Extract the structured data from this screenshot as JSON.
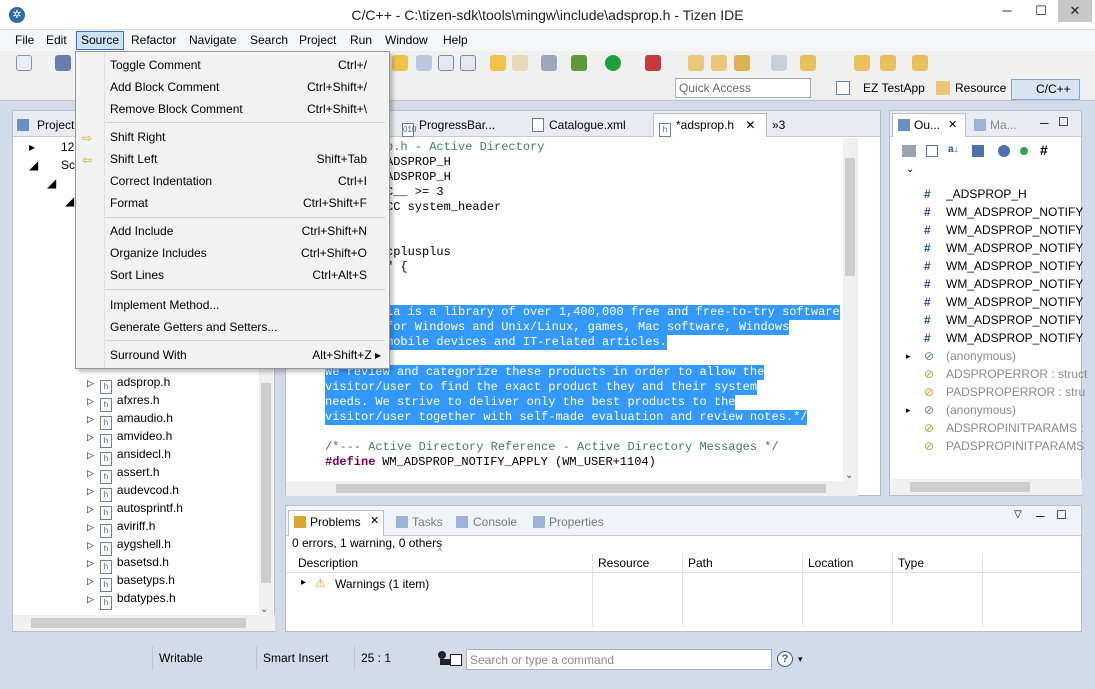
{
  "window": {
    "title": "C/C++ - C:\\tizen-sdk\\tools\\mingw\\include\\adsprop.h - Tizen IDE"
  },
  "menubar": [
    "File",
    "Edit",
    "Source",
    "Refactor",
    "Navigate",
    "Search",
    "Project",
    "Run",
    "Window",
    "Help"
  ],
  "quick_access": {
    "placeholder": "Quick Access"
  },
  "perspectives": [
    "EZ TestApp",
    "Resource",
    "C/C++"
  ],
  "source_menu": {
    "g1": [
      {
        "label": "Toggle Comment",
        "shortcut": "Ctrl+/"
      },
      {
        "label": "Add Block Comment",
        "shortcut": "Ctrl+Shift+/"
      },
      {
        "label": "Remove Block Comment",
        "shortcut": "Ctrl+Shift+\\"
      }
    ],
    "g2": [
      {
        "label": "Shift Right",
        "shortcut": ""
      },
      {
        "label": "Shift Left",
        "shortcut": "Shift+Tab"
      },
      {
        "label": "Correct Indentation",
        "shortcut": "Ctrl+I"
      },
      {
        "label": "Format",
        "shortcut": "Ctrl+Shift+F"
      }
    ],
    "g3": [
      {
        "label": "Add Include",
        "shortcut": "Ctrl+Shift+N"
      },
      {
        "label": "Organize Includes",
        "shortcut": "Ctrl+Shift+O"
      },
      {
        "label": "Sort Lines",
        "shortcut": "Ctrl+Alt+S"
      }
    ],
    "g4": [
      {
        "label": "Implement Method...",
        "shortcut": ""
      },
      {
        "label": "Generate Getters and Setters...",
        "shortcut": ""
      }
    ],
    "g5": [
      {
        "label": "Surround With",
        "shortcut": "Alt+Shift+Z ▸"
      }
    ]
  },
  "project_explorer": {
    "tab": "Project",
    "partial_rows": [
      "12",
      "Sc"
    ],
    "files": [
      "adsprop.h",
      "afxres.h",
      "amaudio.h",
      "amvideo.h",
      "ansidecl.h",
      "assert.h",
      "audevcod.h",
      "autosprintf.h",
      "aviriff.h",
      "aygshell.h",
      "basetsd.h",
      "basetyps.h",
      "bdatypes.h"
    ]
  },
  "editor": {
    "tabs": [
      "ProgressBar...",
      "Catalogue.xml",
      "*adsprop.h",
      "»3"
    ],
    "lines": [
      "p.h - Active Directory",
      "ADSPROP_H",
      "ADSPROP_H",
      "C__ >= 3",
      "CC system_header",
      "",
      "",
      "cplusplus",
      "\" {",
      "",
      "",
      "ia is a library of over 1,400,000 free and free-to-try software",
      "for Windows and Unix/Linux, games, Mac software, Windows",
      "mobile devices and IT-related articles.",
      "",
      "We review and categorize these products in order to allow the",
      "visitor/user to find the exact product they and their system",
      "needs. We strive to deliver only the best products to the",
      "visitor/user together with self-made evaluation and review notes.*/",
      "",
      "/*--- Active Directory Reference - Active Directory Messages */",
      "#define",
      " WM_ADSPROP_NOTIFY_APPLY (WM_USER+1104)"
    ]
  },
  "outline": {
    "tabs": [
      "Ou...",
      "Ma..."
    ],
    "items": [
      {
        "type": "hash",
        "label": "_ADSPROP_H"
      },
      {
        "type": "hash",
        "label": "WM_ADSPROP_NOTIFY"
      },
      {
        "type": "hash",
        "label": "WM_ADSPROP_NOTIFY"
      },
      {
        "type": "hash",
        "label": "WM_ADSPROP_NOTIFY"
      },
      {
        "type": "hash",
        "label": "WM_ADSPROP_NOTIFY"
      },
      {
        "type": "hash",
        "label": "WM_ADSPROP_NOTIFY"
      },
      {
        "type": "hash",
        "label": "WM_ADSPROP_NOTIFY"
      },
      {
        "type": "hash",
        "label": "WM_ADSPROP_NOTIFY"
      },
      {
        "type": "hash",
        "label": "WM_ADSPROP_NOTIFY"
      },
      {
        "type": "anon",
        "label": "(anonymous)"
      },
      {
        "type": "struct",
        "label": "ADSPROPERROR : struct"
      },
      {
        "type": "struct",
        "label": "PADSPROPERROR : stru"
      },
      {
        "type": "anon",
        "label": "(anonymous)"
      },
      {
        "type": "struct",
        "label": "ADSPROPINITPARAMS :"
      },
      {
        "type": "struct",
        "label": "PADSPROPINITPARAMS"
      }
    ]
  },
  "problems": {
    "tabs": [
      "Problems",
      "Tasks",
      "Console",
      "Properties"
    ],
    "summary": "0 errors, 1 warning, 0 others",
    "columns": [
      "Description",
      "Resource",
      "Path",
      "Location",
      "Type"
    ],
    "rows": [
      {
        "label": "Warnings (1 item)"
      }
    ]
  },
  "status": {
    "writable": "Writable",
    "insert_mode": "Smart Insert",
    "position": "25 : 1",
    "command_placeholder": "Search or type a command"
  }
}
